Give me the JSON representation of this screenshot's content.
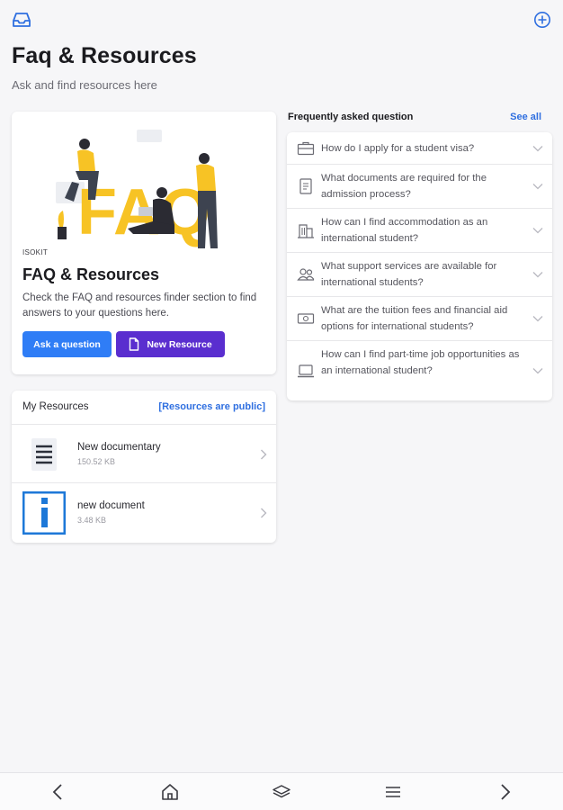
{
  "header": {
    "inbox_icon": "inbox-icon",
    "add_icon": "plus-circle-icon",
    "title": "Faq & Resources",
    "subtitle": "Ask and find resources here"
  },
  "hero": {
    "eyebrow": "ISOKIT",
    "title": "FAQ & Resources",
    "description": "Check the FAQ and resources finder section to find answers to your questions here.",
    "ask_button": "Ask a question",
    "new_resource_button": "New Resource",
    "illustration_text": "FAQ"
  },
  "resources": {
    "label": "My Resources",
    "public_link": "[Resources are public]",
    "items": [
      {
        "name": "New documentary",
        "size": "150.52 KB",
        "icon": "document-lines-icon"
      },
      {
        "name": "new document",
        "size": "3.48 KB",
        "icon": "info-icon"
      }
    ]
  },
  "faq": {
    "label": "Frequently asked question",
    "see_all": "See all",
    "items": [
      {
        "question": "How do I apply for a student visa?",
        "icon": "briefcase-icon"
      },
      {
        "question": "What documents are required for the admission process?",
        "icon": "document-icon"
      },
      {
        "question": "How can I find accommodation as an international student?",
        "icon": "building-icon"
      },
      {
        "question": "What support services are available for international students?",
        "icon": "people-icon"
      },
      {
        "question": "What are the tuition fees and financial aid options for international students?",
        "icon": "money-icon"
      },
      {
        "question": "How can I find part-time job opportunities as an international student?",
        "icon": "laptop-icon"
      }
    ]
  },
  "colors": {
    "primary_blue": "#2f7df6",
    "purple": "#5a2ecf",
    "link_blue": "#2f6fe0",
    "illustration_yellow": "#f7c325"
  },
  "bottom_nav": [
    "back-icon",
    "home-icon",
    "layers-icon",
    "menu-icon",
    "forward-icon"
  ]
}
